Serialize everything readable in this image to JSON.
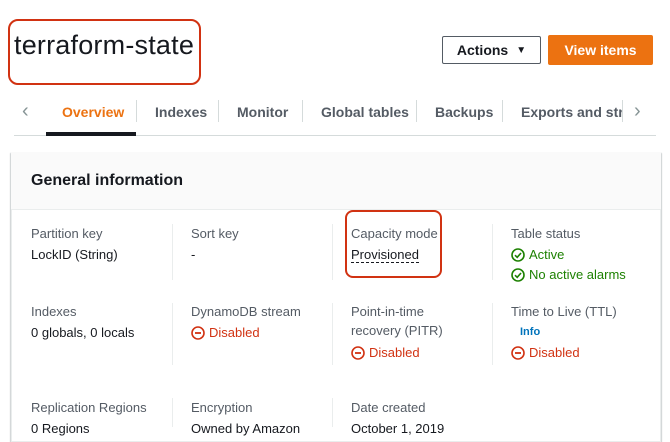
{
  "page": {
    "title": "terraform-state"
  },
  "header": {
    "actions_label": "Actions",
    "view_items_label": "View items"
  },
  "tabs": [
    {
      "label": "Overview"
    },
    {
      "label": "Indexes"
    },
    {
      "label": "Monitor"
    },
    {
      "label": "Global tables"
    },
    {
      "label": "Backups"
    },
    {
      "label": "Exports and streams"
    }
  ],
  "panel": {
    "title": "General information",
    "partition_key": {
      "label": "Partition key",
      "value": "LockID (String)"
    },
    "sort_key": {
      "label": "Sort key",
      "value": "-"
    },
    "capacity_mode": {
      "label": "Capacity mode",
      "value": "Provisioned"
    },
    "table_status": {
      "label": "Table status",
      "active": "Active",
      "alarms": "No active alarms"
    },
    "indexes": {
      "label": "Indexes",
      "value": "0 globals, 0 locals"
    },
    "stream": {
      "label": "DynamoDB stream",
      "value": "Disabled"
    },
    "pitr": {
      "label_line1": "Point-in-time",
      "label_line2": "recovery (PITR)",
      "value": "Disabled"
    },
    "ttl": {
      "label": "Time to Live (TTL)",
      "info": "Info",
      "value": "Disabled"
    },
    "replication": {
      "label": "Replication Regions",
      "value": "0 Regions"
    },
    "encryption": {
      "label": "Encryption",
      "value": "Owned by Amazon"
    },
    "date_created": {
      "label": "Date created",
      "value": "October 1, 2019"
    }
  },
  "colors": {
    "accent": "#ec7211",
    "success": "#1d8102",
    "error": "#d13212",
    "link": "#0073bb"
  }
}
